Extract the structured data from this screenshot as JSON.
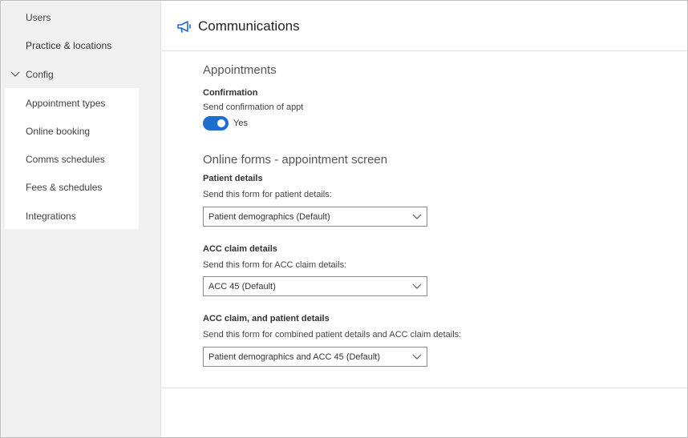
{
  "sidebar": {
    "items": [
      {
        "label": "Users"
      },
      {
        "label": "Practice & locations"
      },
      {
        "label": "Config"
      }
    ],
    "config_items": [
      {
        "label": "Appointment types"
      },
      {
        "label": "Online booking"
      },
      {
        "label": "Comms schedules"
      },
      {
        "label": "Fees & schedules"
      },
      {
        "label": "Integrations"
      }
    ]
  },
  "header": {
    "title": "Communications",
    "icon": "megaphone-icon",
    "icon_color": "#1f6dd1"
  },
  "appointments": {
    "title": "Appointments",
    "confirmation": {
      "label": "Confirmation",
      "description": "Send confirmation of appt",
      "toggle_on": true,
      "toggle_text": "Yes",
      "toggle_color": "#1f6dd1"
    }
  },
  "online_forms": {
    "title": "Online forms - appointment screen",
    "patient_details": {
      "label": "Patient details",
      "description": "Send this form for patient details:",
      "value": "Patient demographics (Default)"
    },
    "acc_claim": {
      "label": "ACC claim details",
      "description": "Send this form for ACC claim details:",
      "value": "ACC 45 (Default)"
    },
    "combined": {
      "label": "ACC claim, and patient details",
      "description": "Send this form for combined patient details and ACC claim details:",
      "value": "Patient demographics and ACC 45 (Default)"
    }
  }
}
